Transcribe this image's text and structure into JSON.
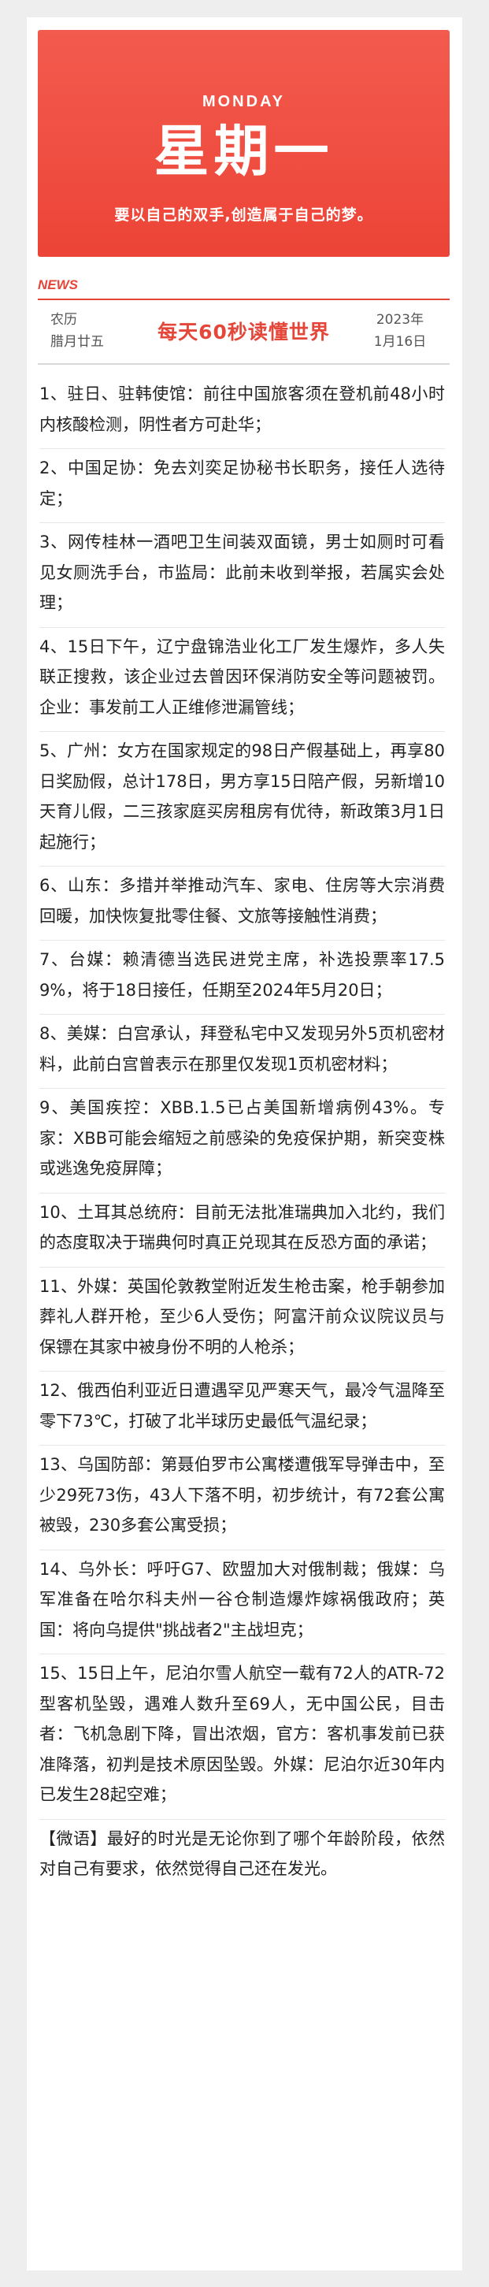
{
  "banner": {
    "day_en": "MONDAY",
    "day_cn": "星期一",
    "motto": "要以自己的双手,创造属于自己的梦。"
  },
  "news_label": "NEWS",
  "header": {
    "lunar_line1": "农历",
    "lunar_line2": "腊月廿五",
    "title": "每天60秒读懂世界",
    "date_line1": "2023年",
    "date_line2": "1月16日"
  },
  "items": [
    "1、驻日、驻韩使馆：前往中国旅客须在登机前48小时内核酸检测，阴性者方可赴华；",
    "2、中国足协：免去刘奕足协秘书长职务，接任人选待定；",
    "3、网传桂林一酒吧卫生间装双面镜，男士如厕时可看见女厕洗手台，市监局：此前未收到举报，若属实会处理；",
    "4、15日下午，辽宁盘锦浩业化工厂发生爆炸，多人失联正搜救，该企业过去曾因环保消防安全等问题被罚。企业：事发前工人正维修泄漏管线；",
    "5、广州：女方在国家规定的98日产假基础上，再享80日奖励假，总计178日，男方享15日陪产假，另新增10天育儿假，二三孩家庭买房租房有优待，新政策3月1日起施行；",
    "6、山东：多措并举推动汽车、家电、住房等大宗消费回暖，加快恢复批零住餐、文旅等接触性消费；",
    "7、台媒：赖清德当选民进党主席，补选投票率17.59%，将于18日接任，任期至2024年5月20日；",
    "8、美媒：白宫承认，拜登私宅中又发现另外5页机密材料，此前白宫曾表示在那里仅发现1页机密材料；",
    "9、美国疾控：XBB.1.5已占美国新增病例43%。专家：XBB可能会缩短之前感染的免疫保护期，新突变株或逃逸免疫屏障；",
    "10、土耳其总统府：目前无法批准瑞典加入北约，我们的态度取决于瑞典何时真正兑现其在反恐方面的承诺；",
    "11、外媒：英国伦敦教堂附近发生枪击案，枪手朝参加葬礼人群开枪，至少6人受伤；阿富汗前众议院议员与保镖在其家中被身份不明的人枪杀；",
    "12、俄西伯利亚近日遭遇罕见严寒天气，最冷气温降至零下73℃，打破了北半球历史最低气温纪录；",
    "13、乌国防部：第聂伯罗市公寓楼遭俄军导弹击中，至少29死73伤，43人下落不明，初步统计，有72套公寓被毁，230多套公寓受损；",
    "14、乌外长：呼吁G7、欧盟加大对俄制裁；俄媒：乌军准备在哈尔科夫州一谷仓制造爆炸嫁祸俄政府；英国：将向乌提供\"挑战者2\"主战坦克；",
    "15、15日上午，尼泊尔雪人航空一载有72人的ATR-72型客机坠毁，遇难人数升至69人，无中国公民，目击者：飞机急剧下降，冒出浓烟，官方：客机事发前已获准降落，初判是技术原因坠毁。外媒：尼泊尔近30年内已发生28起空难；",
    "【微语】最好的时光是无论你到了哪个年龄阶段，依然对自己有要求，依然觉得自己还在发光。"
  ]
}
